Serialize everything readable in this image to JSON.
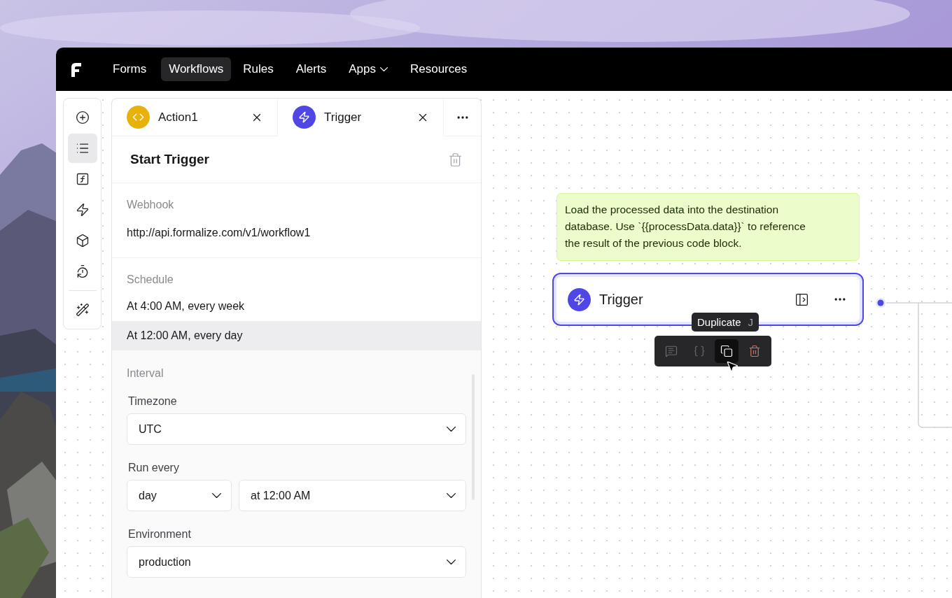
{
  "nav": {
    "items": [
      {
        "label": "Forms",
        "selected": false,
        "dropdown": false
      },
      {
        "label": "Workflows",
        "selected": true,
        "dropdown": false
      },
      {
        "label": "Rules",
        "selected": false,
        "dropdown": false
      },
      {
        "label": "Alerts",
        "selected": false,
        "dropdown": false
      },
      {
        "label": "Apps",
        "selected": false,
        "dropdown": true
      },
      {
        "label": "Resources",
        "selected": false,
        "dropdown": false
      }
    ]
  },
  "tool_rail": {
    "items": [
      {
        "kind": "add",
        "selected": false
      },
      {
        "kind": "list",
        "selected": true
      },
      {
        "kind": "function",
        "selected": false
      },
      {
        "kind": "bolt",
        "selected": false
      },
      {
        "kind": "cube",
        "selected": false
      },
      {
        "kind": "timer",
        "selected": false
      },
      {
        "kind": "wand",
        "selected": false
      }
    ]
  },
  "tabs": [
    {
      "label": "Action1",
      "kind": "code",
      "color": "#e8b10c",
      "selected": false
    },
    {
      "label": "Trigger",
      "kind": "bolt",
      "color": "#4f46e5",
      "selected": true
    }
  ],
  "panel": {
    "title": "Start Trigger",
    "webhook": {
      "label": "Webhook",
      "value": "http://api.formalize.com/v1/workflow1"
    },
    "schedule": {
      "label": "Schedule",
      "options": [
        {
          "label": "At 4:00 AM, every week",
          "selected": false
        },
        {
          "label": "At 12:00 AM, every day",
          "selected": true
        }
      ]
    },
    "interval": {
      "label": "Interval",
      "fields": [
        {
          "label": "Timezone",
          "selects": [
            {
              "value": "UTC"
            }
          ]
        },
        {
          "label": "Run every",
          "selects": [
            {
              "value": "day"
            },
            {
              "value": "at 12:00 AM"
            }
          ]
        },
        {
          "label": "Environment",
          "selects": [
            {
              "value": "production"
            }
          ]
        }
      ]
    }
  },
  "canvas": {
    "note": "Load the processed data into the destination database. Use `{{processData.data}}` to reference the result of the previous code block.",
    "node": {
      "title": "Trigger",
      "selected": true
    },
    "tooltip": {
      "label": "Duplicate",
      "shortcut": "J"
    },
    "node_actions": [
      {
        "kind": "comment",
        "disabled": true,
        "hovered": false
      },
      {
        "kind": "braces",
        "disabled": true,
        "hovered": false
      },
      {
        "kind": "copy",
        "disabled": false,
        "hovered": true
      },
      {
        "kind": "delete",
        "disabled": false,
        "hovered": false
      }
    ]
  }
}
